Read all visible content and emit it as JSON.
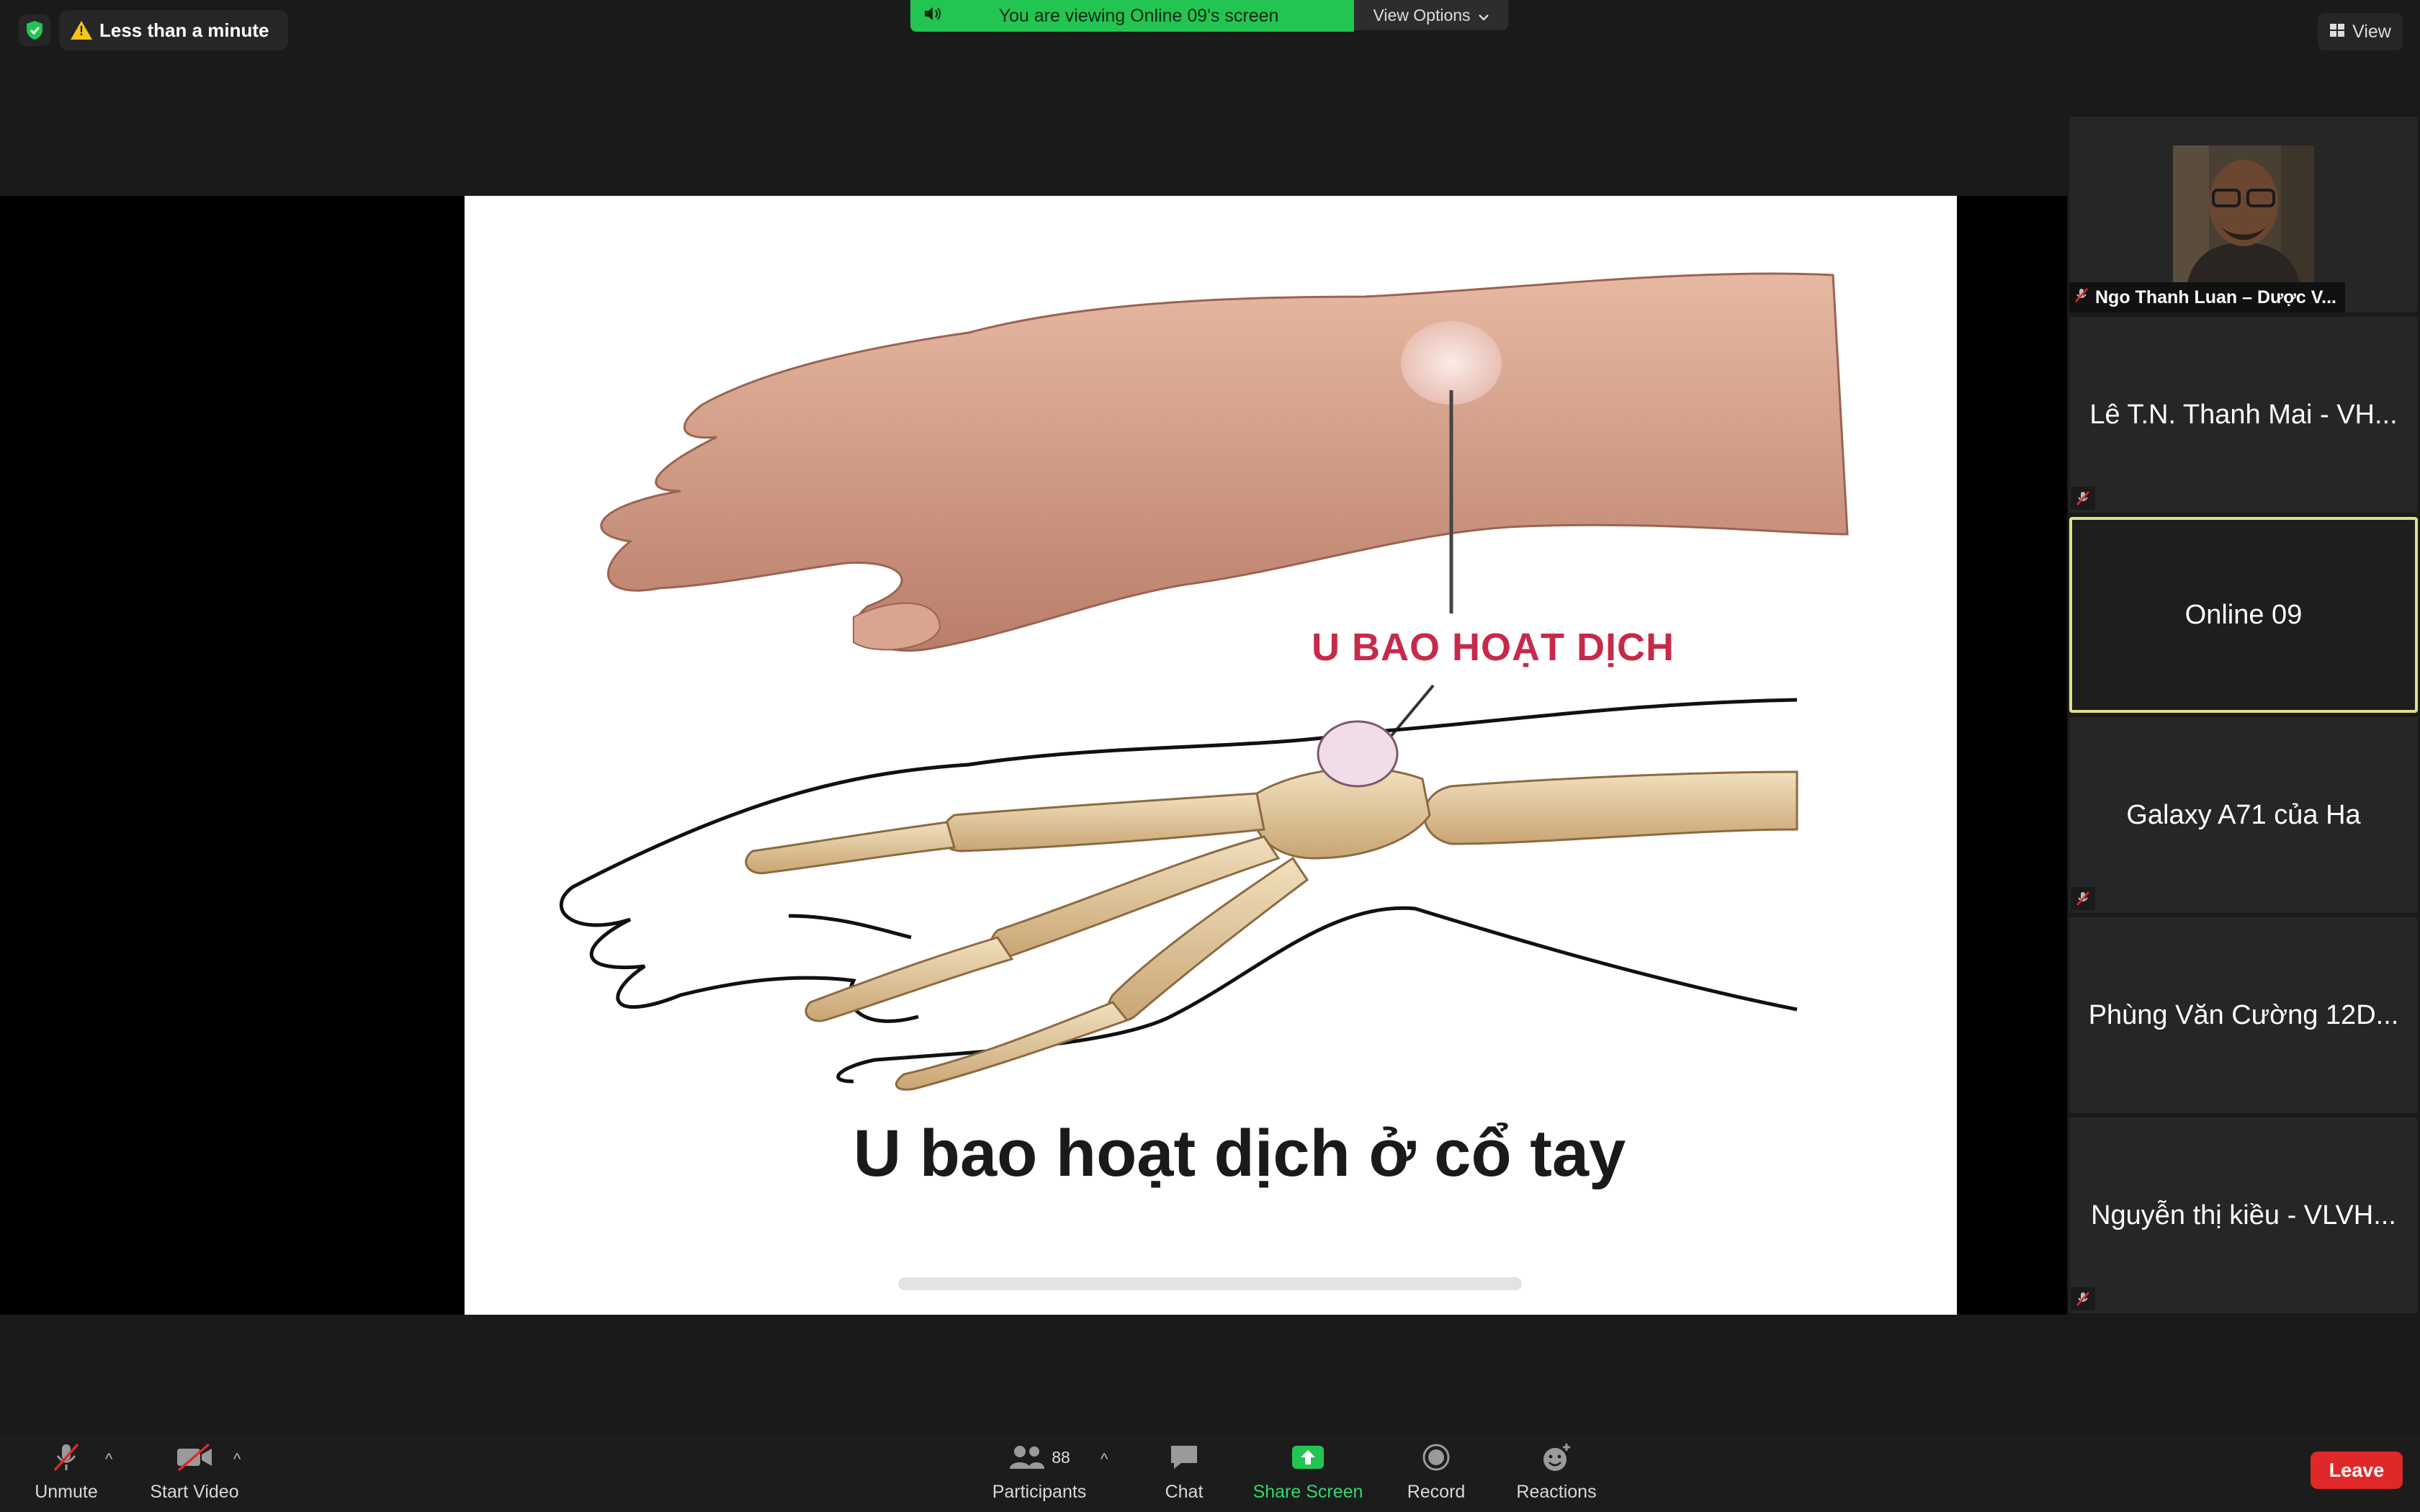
{
  "top": {
    "timer_text": "Less than a minute",
    "banner_text": "You are viewing Online 09's screen",
    "view_options_label": "View Options",
    "view_label": "View"
  },
  "slide": {
    "callout_label": "U BAO HOẠT DỊCH",
    "title": "U bao hoạt dịch ở cổ tay"
  },
  "participants": [
    {
      "name": "Ngo Thanh Luan – Dược V...",
      "muted": true,
      "has_video": true
    },
    {
      "name": "Lê T.N. Thanh Mai - VH...",
      "muted": true
    },
    {
      "name": "Online 09",
      "muted": false,
      "active_speaker": true
    },
    {
      "name": "Galaxy A71 của Ha",
      "muted": true
    },
    {
      "name": "Phùng Văn Cường 12D...",
      "muted": false
    },
    {
      "name": "Nguyễn thị kiều - VLVH...",
      "muted": true
    }
  ],
  "toolbar": {
    "unmute": "Unmute",
    "start_video": "Start Video",
    "participants": "Participants",
    "participants_count": "88",
    "chat": "Chat",
    "share_screen": "Share Screen",
    "record": "Record",
    "reactions": "Reactions",
    "leave": "Leave"
  },
  "colors": {
    "banner_green": "#23c552",
    "active_border": "#dfe08a",
    "leave_red": "#e02828",
    "share_green": "#35d66b",
    "callout_red": "#c62a4a"
  }
}
